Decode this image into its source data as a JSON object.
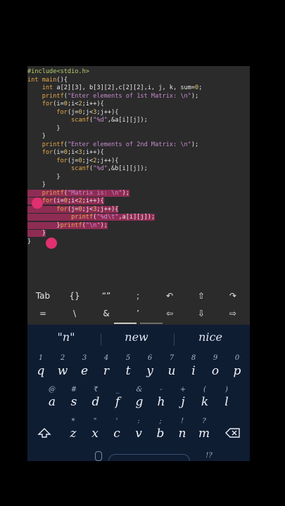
{
  "code": {
    "lines": [
      {
        "segments": [
          {
            "c": "inc",
            "t": "#include<stdio.h>"
          }
        ]
      },
      {
        "segments": [
          {
            "c": "kw",
            "t": "int "
          },
          {
            "c": "fn",
            "t": "main"
          },
          {
            "c": "plain",
            "t": "(){"
          }
        ]
      },
      {
        "segments": [
          {
            "c": "plain",
            "t": "    "
          },
          {
            "c": "kw",
            "t": "int "
          },
          {
            "c": "plain",
            "t": "a[2][3], b[3][2],c[2][2],i, j, k, sum="
          },
          {
            "c": "num",
            "t": "0"
          },
          {
            "c": "plain",
            "t": ";"
          }
        ]
      },
      {
        "segments": [
          {
            "c": "plain",
            "t": "    "
          },
          {
            "c": "fn",
            "t": "printf"
          },
          {
            "c": "plain",
            "t": "("
          },
          {
            "c": "str",
            "t": "\"Enter elements of 1st Matrix: \\n\""
          },
          {
            "c": "plain",
            "t": ");"
          }
        ]
      },
      {
        "segments": [
          {
            "c": "plain",
            "t": "    "
          },
          {
            "c": "kw",
            "t": "for"
          },
          {
            "c": "plain",
            "t": "(i="
          },
          {
            "c": "num",
            "t": "0"
          },
          {
            "c": "plain",
            "t": ";i<"
          },
          {
            "c": "num",
            "t": "2"
          },
          {
            "c": "plain",
            "t": ";i++){"
          }
        ]
      },
      {
        "segments": [
          {
            "c": "plain",
            "t": "        "
          },
          {
            "c": "kw",
            "t": "for"
          },
          {
            "c": "plain",
            "t": "(j="
          },
          {
            "c": "num",
            "t": "0"
          },
          {
            "c": "plain",
            "t": ";j<"
          },
          {
            "c": "num",
            "t": "3"
          },
          {
            "c": "plain",
            "t": ";j++){"
          }
        ]
      },
      {
        "segments": [
          {
            "c": "plain",
            "t": "            "
          },
          {
            "c": "fn",
            "t": "scanf"
          },
          {
            "c": "plain",
            "t": "("
          },
          {
            "c": "str",
            "t": "\"%d\""
          },
          {
            "c": "plain",
            "t": ",&a[i][j]);"
          }
        ]
      },
      {
        "segments": [
          {
            "c": "plain",
            "t": "        }"
          }
        ]
      },
      {
        "segments": [
          {
            "c": "plain",
            "t": "    }"
          }
        ]
      },
      {
        "segments": [
          {
            "c": "plain",
            "t": "    "
          },
          {
            "c": "fn",
            "t": "printf"
          },
          {
            "c": "plain",
            "t": "("
          },
          {
            "c": "str",
            "t": "\"Enter elements of 2nd Matrix: \\n\""
          },
          {
            "c": "plain",
            "t": ");"
          }
        ]
      },
      {
        "segments": [
          {
            "c": "plain",
            "t": "    "
          },
          {
            "c": "kw",
            "t": "for"
          },
          {
            "c": "plain",
            "t": "(i="
          },
          {
            "c": "num",
            "t": "0"
          },
          {
            "c": "plain",
            "t": ";i<"
          },
          {
            "c": "num",
            "t": "3"
          },
          {
            "c": "plain",
            "t": ";i++){"
          }
        ]
      },
      {
        "segments": [
          {
            "c": "plain",
            "t": "        "
          },
          {
            "c": "kw",
            "t": "for"
          },
          {
            "c": "plain",
            "t": "(j="
          },
          {
            "c": "num",
            "t": "0"
          },
          {
            "c": "plain",
            "t": ";j<"
          },
          {
            "c": "num",
            "t": "2"
          },
          {
            "c": "plain",
            "t": ";j++){"
          }
        ]
      },
      {
        "segments": [
          {
            "c": "plain",
            "t": "            "
          },
          {
            "c": "fn",
            "t": "scanf"
          },
          {
            "c": "plain",
            "t": "("
          },
          {
            "c": "str",
            "t": "\"%d\""
          },
          {
            "c": "plain",
            "t": ",&b[i][j]);"
          }
        ]
      },
      {
        "segments": [
          {
            "c": "plain",
            "t": "        }"
          }
        ]
      },
      {
        "segments": [
          {
            "c": "plain",
            "t": "    }"
          }
        ]
      },
      {
        "segments": [
          {
            "c": "plain",
            "t": "    "
          },
          {
            "c": "fn",
            "t": "printf"
          },
          {
            "c": "plain",
            "t": "("
          },
          {
            "c": "str",
            "t": "\"Matrix is: \\n\""
          },
          {
            "c": "plain",
            "t": ");"
          }
        ],
        "sel": true
      },
      {
        "segments": [
          {
            "c": "plain",
            "t": "    "
          },
          {
            "c": "kw",
            "t": "for"
          },
          {
            "c": "plain",
            "t": "(i="
          },
          {
            "c": "num",
            "t": "0"
          },
          {
            "c": "plain",
            "t": ";i<"
          },
          {
            "c": "num",
            "t": "2"
          },
          {
            "c": "plain",
            "t": ";i++){"
          }
        ],
        "sel": true
      },
      {
        "segments": [
          {
            "c": "plain",
            "t": "        "
          },
          {
            "c": "kw",
            "t": "for"
          },
          {
            "c": "plain",
            "t": "(j="
          },
          {
            "c": "num",
            "t": "0"
          },
          {
            "c": "plain",
            "t": ";j<"
          },
          {
            "c": "num",
            "t": "3"
          },
          {
            "c": "plain",
            "t": ";j++){"
          }
        ],
        "sel": true
      },
      {
        "segments": [
          {
            "c": "plain",
            "t": "            "
          },
          {
            "c": "fn",
            "t": "printf"
          },
          {
            "c": "plain",
            "t": "("
          },
          {
            "c": "str",
            "t": "\"%d\\t\""
          },
          {
            "c": "plain",
            "t": ",a[i][j]);"
          }
        ],
        "sel": true
      },
      {
        "segments": [
          {
            "c": "plain",
            "t": "        }"
          },
          {
            "c": "fn",
            "t": "printf"
          },
          {
            "c": "plain",
            "t": "("
          },
          {
            "c": "str",
            "t": "\"\\n\""
          },
          {
            "c": "plain",
            "t": ");"
          }
        ],
        "sel": true
      },
      {
        "segments": [
          {
            "c": "plain",
            "t": "    }"
          }
        ],
        "sel": true
      },
      {
        "segments": [
          {
            "c": "plain",
            "t": "}"
          }
        ]
      }
    ]
  },
  "symbol_bar": {
    "row1": [
      "Tab",
      "{}",
      "“”",
      ";",
      "↶",
      "⇧",
      "↷"
    ],
    "row2": [
      "=",
      "\\",
      "&",
      "’",
      "⇦",
      "⇩",
      "⇨"
    ]
  },
  "suggestions": [
    "\"n\"",
    "new",
    "nice"
  ],
  "keyboard": {
    "row1_hints": [
      "1",
      "2",
      "3",
      "4",
      "5",
      "6",
      "7",
      "8",
      "9",
      "0"
    ],
    "row1": [
      "q",
      "w",
      "e",
      "r",
      "t",
      "y",
      "u",
      "i",
      "o",
      "p"
    ],
    "row2_hints": [
      "@",
      "#",
      "₹",
      "_",
      "&",
      "-",
      "+",
      "(",
      ")"
    ],
    "row2": [
      "a",
      "s",
      "d",
      "f",
      "g",
      "h",
      "j",
      "k",
      "l"
    ],
    "row3_hints": [
      "*",
      "\"",
      "'",
      ":",
      ";",
      "!",
      "?"
    ],
    "row3": [
      "z",
      "x",
      "c",
      "v",
      "b",
      "n",
      "m"
    ],
    "shift_icon": "shift-icon",
    "backspace_icon": "backspace-icon",
    "bottom_hint": "!?"
  },
  "colors": {
    "selection": "#cd2d6e",
    "keyboard_bg": "#0f1d33",
    "editor_bg": "#2b2b2b",
    "keyword": "#e6a94a",
    "string": "#c88ad0",
    "include": "#b6cf6d"
  }
}
